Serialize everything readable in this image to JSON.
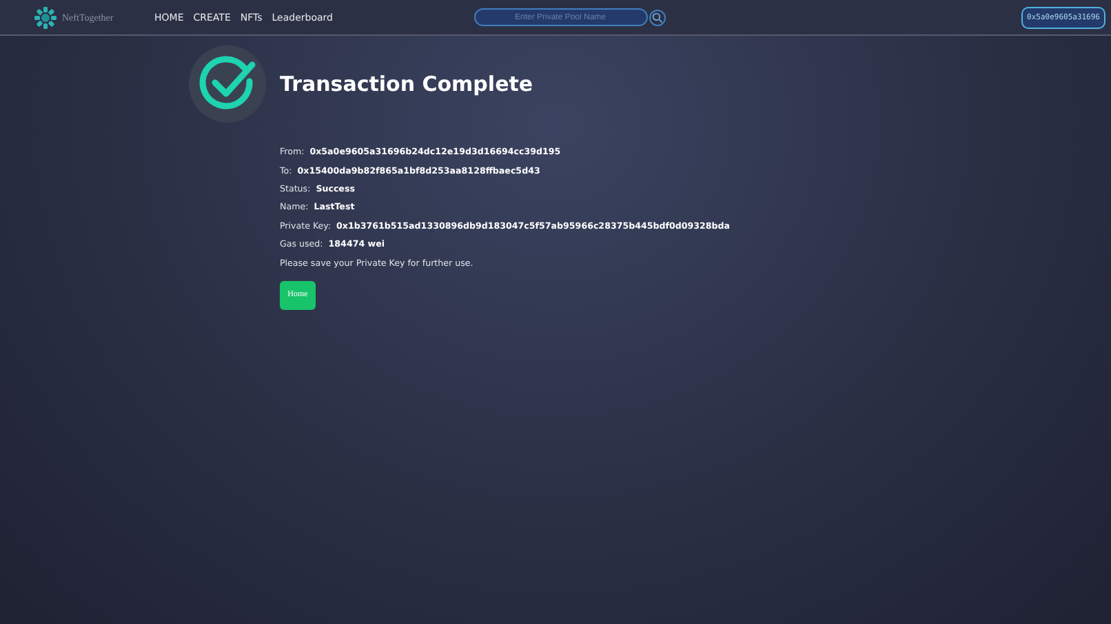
{
  "nav": {
    "brand": "NeftTogether",
    "links": [
      "HOME",
      "CREATE",
      "NFTs",
      "Leaderboard"
    ],
    "search": {
      "placeholder": "Enter Private Pool Name"
    },
    "account": "0x5a0e9605a31696"
  },
  "title": "Transaction Complete",
  "details": [
    {
      "label": "From:",
      "value": "0x5a0e9605a31696b24dc12e19d3d16694cc39d195"
    },
    {
      "label": "To:",
      "value": "0x15400da9b82f865a1bf8d253aa8128ffbaec5d43"
    },
    {
      "label": "Status:",
      "value": "Success"
    },
    {
      "label": "Name:",
      "value": "LastTest"
    },
    {
      "label": "Private Key:",
      "value": "0x1b3761b515ad1330896db9d183047c5f57ab95966c28375b445bdf0d09328bda"
    },
    {
      "label": "Gas used:",
      "value": "184474 wei"
    }
  ],
  "note": "Please save your Private Key for further use.",
  "button": "Home"
}
